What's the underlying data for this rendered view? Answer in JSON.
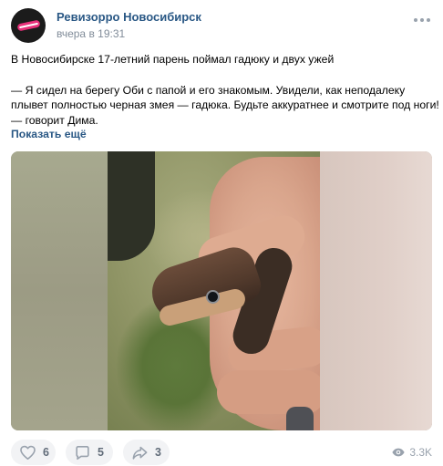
{
  "post": {
    "author": "Ревизорро Новосибирск",
    "time": "вчера в 19:31",
    "text": {
      "line1": "В Новосибирске 17-летний парень поймал гадюку и двух ужей",
      "line2": "— Я сидел на берегу Оби с папой и его знакомым. Увидели, как неподалеку",
      "line3": "плывет полностью черная змея — гадюка. Будьте аккуратнее и смотрите под ноги!",
      "line4": "— говорит Дима."
    },
    "show_more": "Показать ещё"
  },
  "actions": {
    "likes": "6",
    "comments": "5",
    "shares": "3",
    "views": "3.3K"
  },
  "icons": {
    "avatar": "revizorro-logo",
    "more": "more-horizontal-icon",
    "like": "heart-icon",
    "comment": "comment-icon",
    "share": "share-icon",
    "views": "eye-icon"
  },
  "colors": {
    "link": "#2a5885",
    "secondary_text": "#818c99",
    "action_bg": "#f2f3f5",
    "action_text": "#626d7a",
    "logo_accent": "#e8307a"
  }
}
